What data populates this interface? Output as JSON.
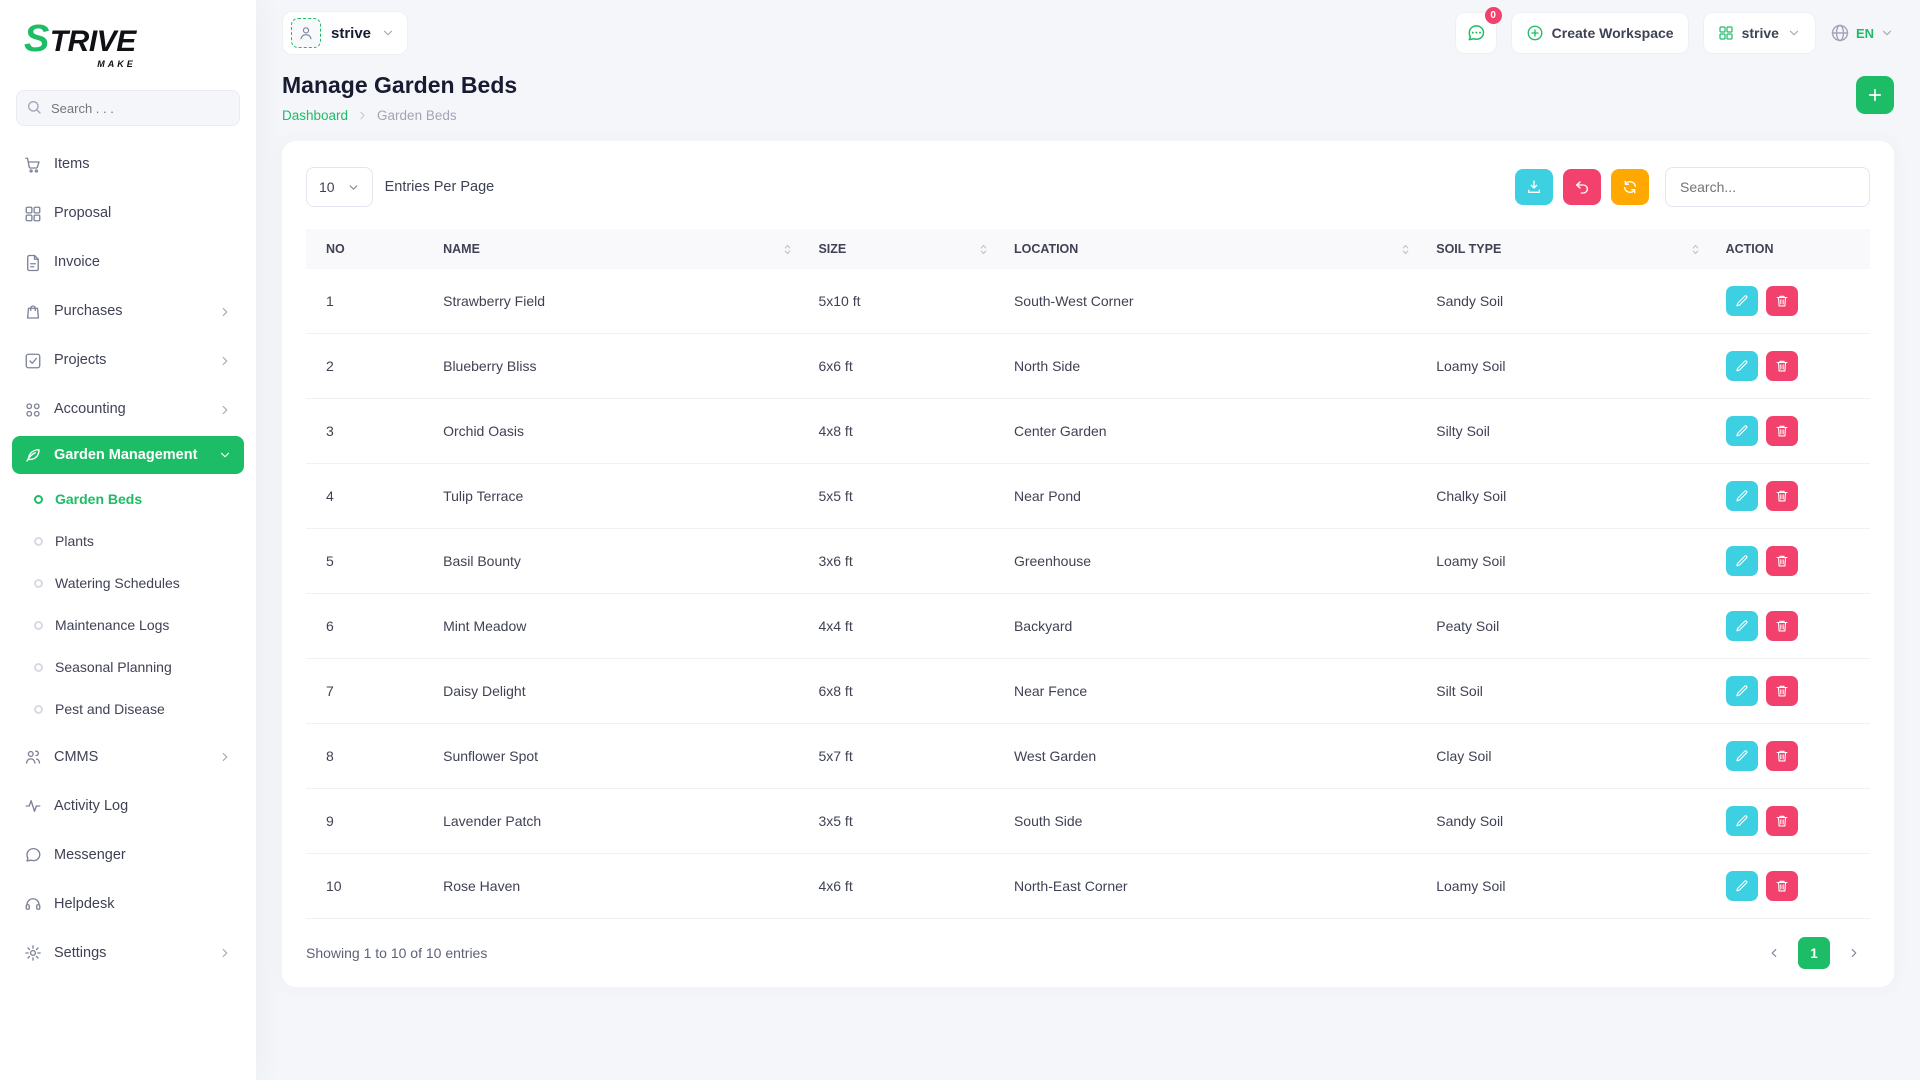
{
  "colors": {
    "primary": "#1dbc66",
    "edit": "#3dd0e2",
    "delete": "#f1416c",
    "warning": "#ffa800",
    "badge": "#f1416c"
  },
  "brand": {
    "name_first": "S",
    "name_rest": "TRIVE",
    "tagline": "MAKE"
  },
  "sidebar": {
    "search_placeholder": "Search . . .",
    "items": [
      {
        "label": "Items"
      },
      {
        "label": "Proposal"
      },
      {
        "label": "Invoice"
      },
      {
        "label": "Purchases"
      },
      {
        "label": "Projects"
      },
      {
        "label": "Accounting"
      },
      {
        "label": "Garden Management"
      },
      {
        "label": "CMMS"
      },
      {
        "label": "Activity Log"
      },
      {
        "label": "Messenger"
      },
      {
        "label": "Helpdesk"
      },
      {
        "label": "Settings"
      }
    ],
    "garden_submenu": [
      {
        "label": "Garden Beds"
      },
      {
        "label": "Plants"
      },
      {
        "label": "Watering Schedules"
      },
      {
        "label": "Maintenance Logs"
      },
      {
        "label": "Seasonal Planning"
      },
      {
        "label": "Pest and Disease"
      }
    ]
  },
  "header": {
    "workspace_name": "strive",
    "chat_badge": "0",
    "create_workspace_label": "Create Workspace",
    "org_name": "strive",
    "language": "EN"
  },
  "page": {
    "title": "Manage Garden Beds",
    "breadcrumb": [
      "Dashboard",
      "Garden Beds"
    ]
  },
  "table": {
    "entries_value": "10",
    "entries_label": "Entries Per Page",
    "search_placeholder": "Search...",
    "columns": [
      "NO",
      "NAME",
      "SIZE",
      "LOCATION",
      "SOIL TYPE",
      "ACTION"
    ],
    "rows": [
      {
        "no": "1",
        "name": "Strawberry Field",
        "size": "5x10 ft",
        "location": "South-West Corner",
        "soil": "Sandy Soil"
      },
      {
        "no": "2",
        "name": "Blueberry Bliss",
        "size": "6x6 ft",
        "location": "North Side",
        "soil": "Loamy Soil"
      },
      {
        "no": "3",
        "name": "Orchid Oasis",
        "size": "4x8 ft",
        "location": "Center Garden",
        "soil": "Silty Soil"
      },
      {
        "no": "4",
        "name": "Tulip Terrace",
        "size": "5x5 ft",
        "location": "Near Pond",
        "soil": "Chalky Soil"
      },
      {
        "no": "5",
        "name": "Basil Bounty",
        "size": "3x6 ft",
        "location": "Greenhouse",
        "soil": "Loamy Soil"
      },
      {
        "no": "6",
        "name": "Mint Meadow",
        "size": "4x4 ft",
        "location": "Backyard",
        "soil": "Peaty Soil"
      },
      {
        "no": "7",
        "name": "Daisy Delight",
        "size": "6x8 ft",
        "location": "Near Fence",
        "soil": "Silt Soil"
      },
      {
        "no": "8",
        "name": "Sunflower Spot",
        "size": "5x7 ft",
        "location": "West Garden",
        "soil": "Clay Soil"
      },
      {
        "no": "9",
        "name": "Lavender Patch",
        "size": "3x5 ft",
        "location": "South Side",
        "soil": "Sandy Soil"
      },
      {
        "no": "10",
        "name": "Rose Haven",
        "size": "4x6 ft",
        "location": "North-East Corner",
        "soil": "Loamy Soil"
      }
    ],
    "showing_text": "Showing 1 to 10 of 10 entries",
    "current_page": "1"
  }
}
